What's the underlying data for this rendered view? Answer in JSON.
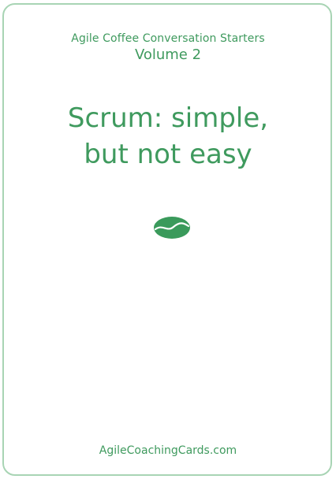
{
  "card": {
    "series": "Agile Coffee Conversation Starters",
    "volume": "Volume 2",
    "title_line1": "Scrum: simple,",
    "title_line2": "but not easy",
    "icon": "coffee-bean-icon",
    "footer": "AgileCoachingCards.com"
  },
  "colors": {
    "text": "#3f9a5e",
    "border": "#a8d4b4",
    "bean": "#3a9a5b"
  }
}
